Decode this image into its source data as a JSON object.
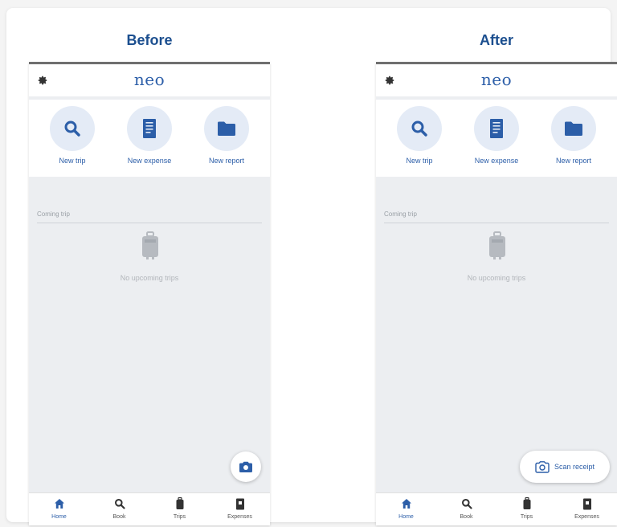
{
  "headings": {
    "before": "Before",
    "after": "After"
  },
  "app": {
    "logo": "neo",
    "actions": [
      {
        "label": "New trip",
        "icon": "search-icon"
      },
      {
        "label": "New expense",
        "icon": "receipt-icon"
      },
      {
        "label": "New report",
        "icon": "folder-icon"
      }
    ],
    "section_title": "Coming trip",
    "empty_state": "No upcoming trips",
    "nav": [
      {
        "label": "Home",
        "icon": "home-icon",
        "active": true
      },
      {
        "label": "Book",
        "icon": "search-icon"
      },
      {
        "label": "Trips",
        "icon": "luggage-icon"
      },
      {
        "label": "Expenses",
        "icon": "expense-icon"
      }
    ]
  },
  "after": {
    "scan_label": "Scan receipt"
  },
  "colors": {
    "brand": "#2c5ea8",
    "action_bg": "#e4ebf6",
    "screen_bg": "#eceef1"
  }
}
